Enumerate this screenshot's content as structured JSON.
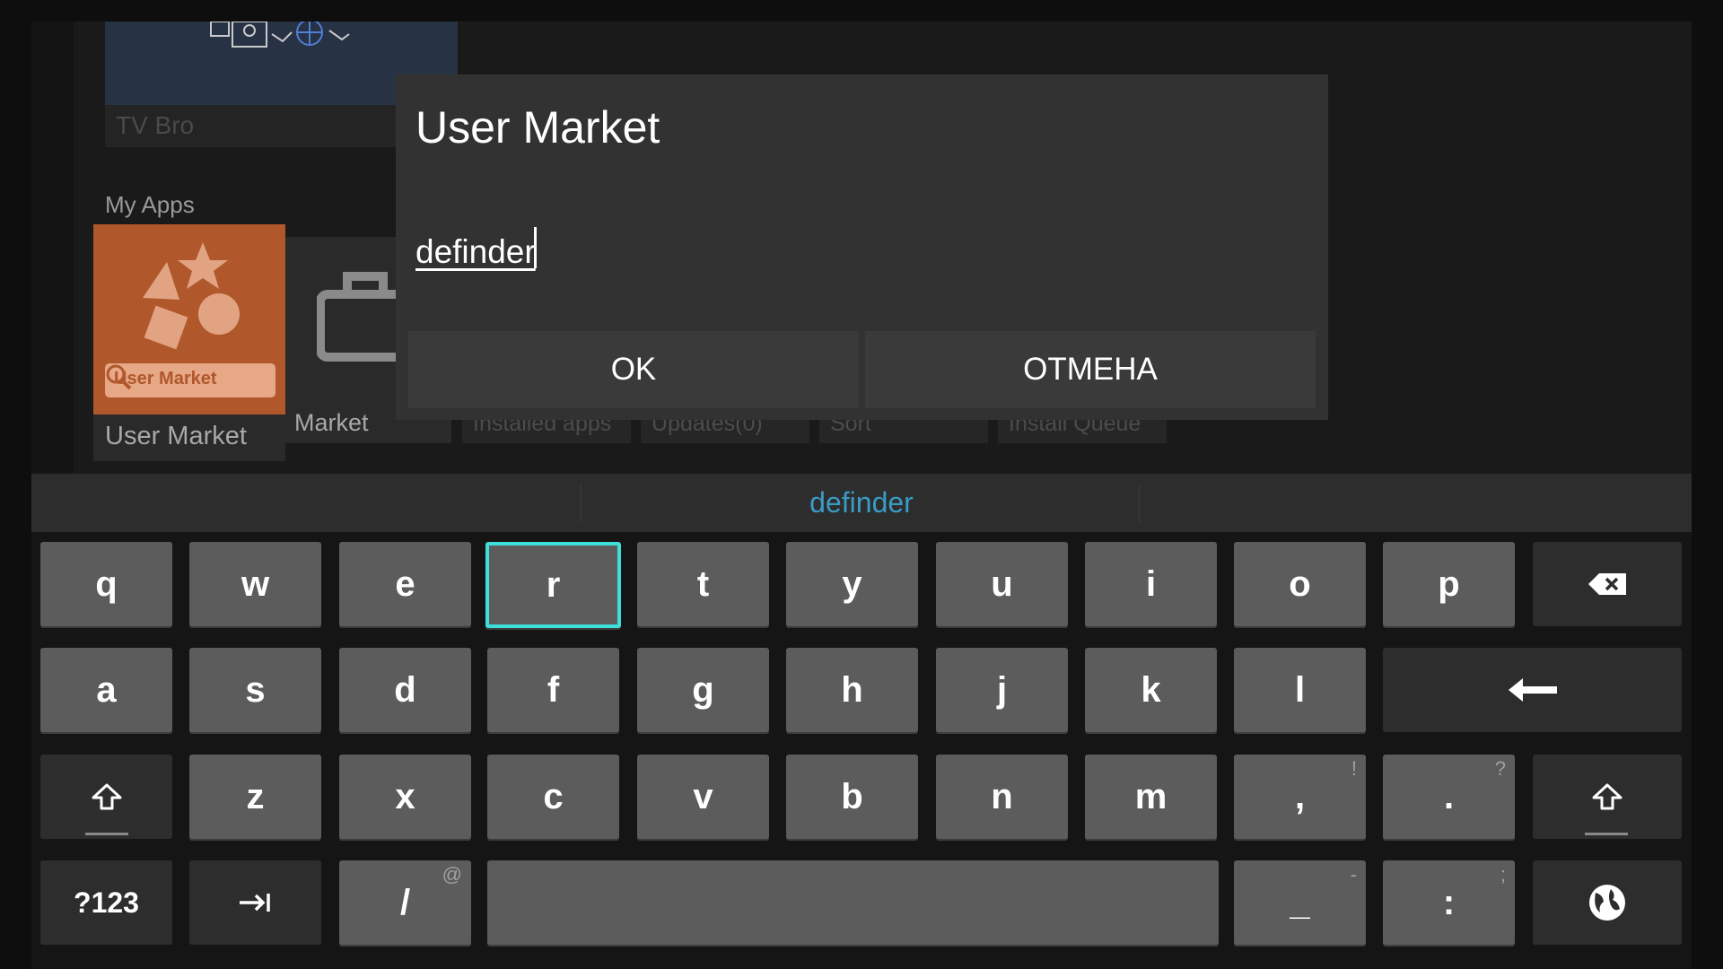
{
  "background": {
    "tv_bro": {
      "label": "TV Bro"
    },
    "section_title": "My Apps",
    "apps": [
      {
        "label": "User Market",
        "search_text": "User Market"
      },
      {
        "label": "Market"
      }
    ],
    "tabs": [
      {
        "label": "Installed apps"
      },
      {
        "label": "Updates(0)"
      },
      {
        "label": "Sort"
      },
      {
        "label": "Install Queue"
      }
    ]
  },
  "dialog": {
    "title": "User Market",
    "input_value": "definder",
    "ok_label": "OK",
    "cancel_label": "ОТМЕНА"
  },
  "keyboard": {
    "suggestion": "definder",
    "accent_color": "#3ddfd9",
    "suggestion_color": "#3a9bc4",
    "focused_key": "r",
    "rows": [
      [
        "q",
        "w",
        "e",
        "r",
        "t",
        "y",
        "u",
        "i",
        "o",
        "p"
      ],
      [
        "a",
        "s",
        "d",
        "f",
        "g",
        "h",
        "j",
        "k",
        "l"
      ],
      [
        "z",
        "x",
        "c",
        "v",
        "b",
        "n",
        "m",
        ",",
        "."
      ],
      [
        "?123",
        "/",
        "_",
        ":"
      ]
    ],
    "hints": {
      "comma": "!",
      "period": "?",
      "slash": "@",
      "underscore": "-",
      "colon": ";"
    },
    "icons": {
      "backspace": "backspace-icon",
      "enter": "enter-arrow-icon",
      "shift": "shift-icon",
      "tab": "tab-icon",
      "language": "globe-icon"
    }
  }
}
